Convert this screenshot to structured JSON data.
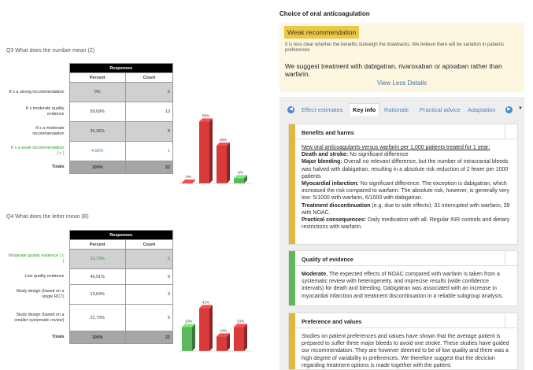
{
  "q3": {
    "title": "Q3 What does the number mean (2)",
    "header": "Responses",
    "col_percent": "Percent",
    "col_count": "Count",
    "rows": [
      {
        "label": "It´s a strong recommendation",
        "percent": "0%",
        "count": "0"
      },
      {
        "label": "It´s moderate quality evidence",
        "percent": "59,09%",
        "count": "13"
      },
      {
        "label": "It´s a moderate recommendation",
        "percent": "36,36%",
        "count": "8"
      },
      {
        "label": "It´s a weak recommendation ( c )",
        "percent": "4,55%",
        "count": "1"
      }
    ],
    "total_label": "Totals",
    "total_percent": "100%",
    "total_count": "22"
  },
  "q4": {
    "title": "Q4 What does the letter mean (B)",
    "header": "Responses",
    "col_percent": "Percent",
    "col_count": "Count",
    "rows": [
      {
        "label": "Moderate quality evidence ( c )",
        "percent": "22,73%",
        "count": "5"
      },
      {
        "label": "Low quality evidence",
        "percent": "40,91%",
        "count": "9"
      },
      {
        "label": "Study design (based on a single RCT)",
        "percent": "13,64%",
        "count": "3"
      },
      {
        "label": "Study design (based on a smaller systematic review)",
        "percent": "22,73%",
        "count": "5"
      }
    ],
    "total_label": "Totals",
    "total_percent": "100%",
    "total_count": "22"
  },
  "chart_data": [
    {
      "type": "bar",
      "categories": [
        "It´s a strong recommendation",
        "It´s moderate quality evidence",
        "It´s a moderate recommendation",
        "It´s a weak recommendation ( c )"
      ],
      "values": [
        0,
        59,
        36,
        5
      ],
      "value_labels": [
        "0%",
        "59%",
        "36%",
        "5%"
      ],
      "colors": [
        "#d93a3a",
        "#d93a3a",
        "#d93a3a",
        "#5cb85c"
      ]
    },
    {
      "type": "bar",
      "categories": [
        "Moderate quality evidence ( c )",
        "Low quality evidence",
        "Study design (based on a single RCT)",
        "Study design (based on a smaller systematic review)"
      ],
      "values": [
        23,
        41,
        14,
        23
      ],
      "value_labels": [
        "23%",
        "41%",
        "14%",
        "23%"
      ],
      "colors": [
        "#5cb85c",
        "#d93a3a",
        "#d93a3a",
        "#d93a3a"
      ]
    }
  ],
  "recommendation": {
    "title": "Choice of oral anticoagulation",
    "badge": "Weak recommendation",
    "note": "It is less clear whether the benefits outweigh the drawbacks. We believe there will be variation in patients preferences",
    "text": "We suggest treatment with dabigatran, rivaroxaban or apixaban rather than warfarin.",
    "details_link": "View Less Details",
    "tabs": [
      "Effect estimates",
      "Key info",
      "Rationale",
      "Practical advice",
      "Adaptation"
    ],
    "active_tab": "Key info",
    "colors": {
      "accent": "#e9c84a",
      "benefits": "#e0b83a",
      "quality": "#5cb85c",
      "preference": "#e0b83a",
      "link": "#4a86c9"
    }
  },
  "cards": {
    "benefits": {
      "title": "Benefits and harms",
      "line1": "New oral anticoagulants versus warfarin per 1,000 patients treated for 1 year:",
      "b1": "Death and stroke:",
      "t1": " No significant difference",
      "b2": "Major bleeding:",
      "t2": " Overall no relevant difference, but the number of intracranial bleeds was halved with dabigatran, resulting in a absolute risk reduction of 2 fewer per 1000 patients",
      "b3": "Myocardial infarction:",
      "t3": " No significant difference. The exception is dabigatran, which increased the risk compared to warfarin. The absolute risk, however, is generally very low: 5/1000 with warfarin, 6/1000 with dabigatran.",
      "b4": "Treatment discontinuation",
      "t4": " (e.g. due to side effects): 31 interrupted with warfarin, 39 with NOAC.",
      "b5": "Practical consequences:",
      "t5": " Daily medication with all. Regular INR controls and dietary restrictions with warfarin."
    },
    "quality": {
      "title": "Quality of evidence",
      "b1": "Moderate.",
      "t1": "  The expected effects of NOAC compared with warfarin is taken from a systematic review with heterogeneity, and imprecise results (wide confidence intervals) for death and bleeding. Dabigatran was associated with an increase in myocardial infarction and treatment discontinuation in a reliable subgroup analysis."
    },
    "preference": {
      "title": "Preference and values",
      "t1": "Studies on patient preferences and values have shown that the average patient is prepared to suffer three major bleeds to avoid one stroke. These studies have guided our recommendation. They are however deemed to be of low quality and there was a high degree of variability in preferences. We therefore suggest that the decicion regarding treatment options is made together with the patient."
    }
  }
}
